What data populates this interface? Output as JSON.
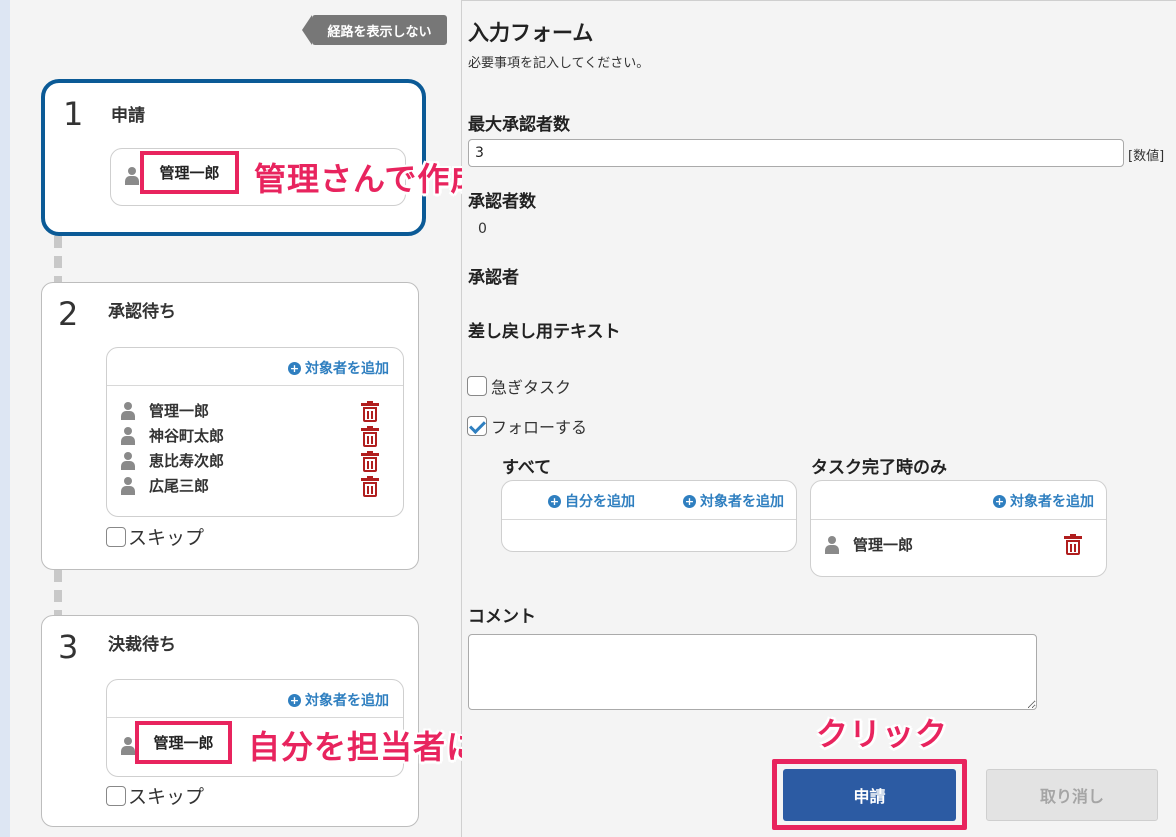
{
  "left": {
    "toggle_route_label": "経路を表示しない",
    "steps": [
      {
        "number": "1",
        "title": "申請",
        "highlighted_user": "管理一郎",
        "annotation": "管理さんで作成"
      },
      {
        "number": "2",
        "title": "承認待ち",
        "add_target_label": "対象者を追加",
        "users": [
          "管理一郎",
          "神谷町太郎",
          "恵比寿次郎",
          "広尾三郎"
        ],
        "skip_label": "スキップ"
      },
      {
        "number": "3",
        "title": "決裁待ち",
        "add_target_label": "対象者を追加",
        "highlighted_user": "管理一郎",
        "annotation": "自分を担当者に設定",
        "skip_label": "スキップ"
      }
    ]
  },
  "form": {
    "title": "入力フォーム",
    "subtitle": "必要事項を記入してください。",
    "max_approvers_label": "最大承認者数",
    "max_approvers_value": "3",
    "max_approvers_unit": "[数値]",
    "approver_count_label": "承認者数",
    "approver_count_value": "0",
    "approvers_label": "承認者",
    "reject_text_label": "差し戻し用テキスト",
    "urgent_label": "急ぎタスク",
    "urgent_checked": false,
    "follow_label": "フォローする",
    "follow_checked": true,
    "follow_all": {
      "label": "すべて",
      "add_self_label": "自分を追加",
      "add_target_label": "対象者を追加"
    },
    "follow_done": {
      "label": "タスク完了時のみ",
      "add_target_label": "対象者を追加",
      "user": "管理一郎"
    },
    "comment_label": "コメント",
    "comment_value": "",
    "submit_label": "申請",
    "cancel_label": "取り消し",
    "click_annotation": "クリック"
  },
  "colors": {
    "accent": "#2c5ba3",
    "highlight": "#e8245e",
    "active_border": "#0b5a96",
    "delete": "#b01e1e",
    "link": "#2f7fc0"
  }
}
